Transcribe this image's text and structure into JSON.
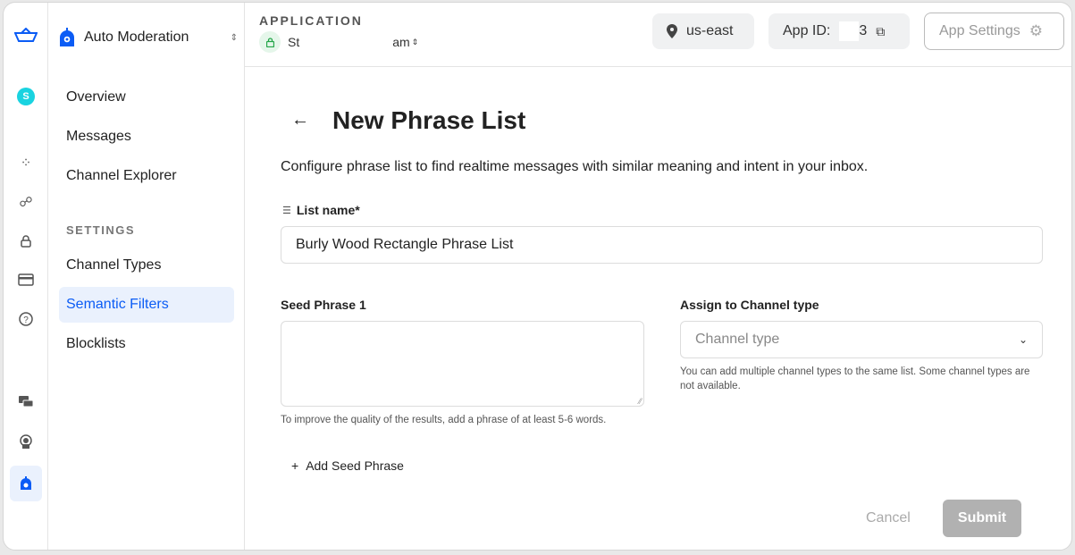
{
  "colors": {
    "accent": "#0b5cf5",
    "avatar": "#19d3e0",
    "active_bg": "#eaf1fd"
  },
  "rail": {
    "avatar_letter": "S",
    "icons": [
      "boat-logo-icon",
      "avatar",
      "apps-add-icon",
      "users-icon",
      "lock-icon",
      "credit-card-icon",
      "help-icon",
      "chat-icon",
      "broadcast-icon",
      "moderation-icon"
    ]
  },
  "nav": {
    "product": "Auto Moderation",
    "items": [
      "Overview",
      "Messages",
      "Channel Explorer"
    ],
    "section": "SETTINGS",
    "settings_items": [
      "Channel Types",
      "Semantic Filters",
      "Blocklists"
    ],
    "active": "Semantic Filters"
  },
  "header": {
    "app_label": "APPLICATION",
    "app_name_start": "St",
    "app_name_end": "am",
    "region": "us-east",
    "app_id_label": "App ID:",
    "app_id_end": "3",
    "settings": "App Settings"
  },
  "form": {
    "title": "New Phrase List",
    "description": "Configure phrase list to find realtime messages with similar meaning and intent in your inbox.",
    "list_name_label": "List name*",
    "list_name_value": "Burly Wood Rectangle Phrase List",
    "seed_label": "Seed Phrase 1",
    "seed_value": "",
    "seed_help": "To improve the quality of the results, add a phrase of at least 5-6 words.",
    "add_seed": "Add Seed Phrase",
    "channel_label": "Assign to Channel type",
    "channel_placeholder": "Channel type",
    "channel_help": "You can add multiple channel types to the same list. Some channel types are not available.",
    "cancel": "Cancel",
    "submit": "Submit"
  }
}
